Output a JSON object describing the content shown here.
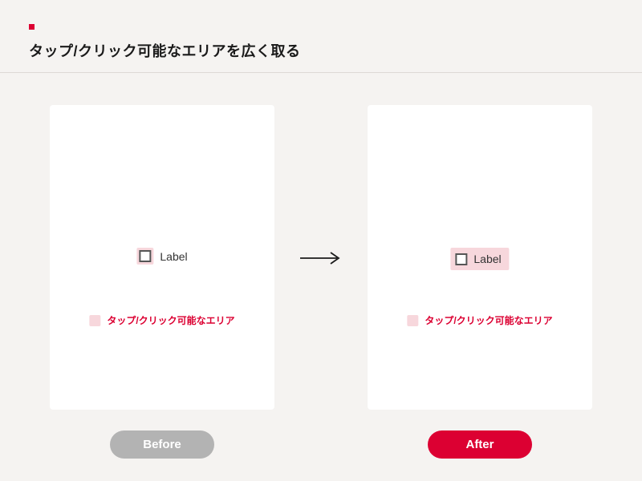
{
  "header": {
    "title": "タップ/クリック可能なエリアを広く取る"
  },
  "before": {
    "badge": "Before",
    "checkbox_label": "Label",
    "legend_text": "タップ/クリック可能なエリア"
  },
  "after": {
    "badge": "After",
    "checkbox_label": "Label",
    "legend_text": "タップ/クリック可能なエリア"
  },
  "colors": {
    "accent": "#dc0032",
    "highlight": "#f7d7dc",
    "muted": "#b3b3b3"
  }
}
